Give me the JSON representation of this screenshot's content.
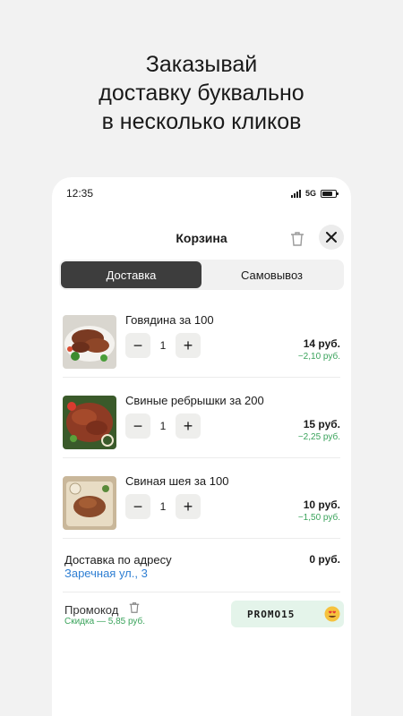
{
  "headline": [
    "Заказывай",
    "доставку буквально",
    "в несколько кликов"
  ],
  "status": {
    "time": "12:35",
    "network": "5G"
  },
  "cart": {
    "title": "Корзина",
    "tabs": [
      {
        "label": "Доставка",
        "active": true
      },
      {
        "label": "Самовывоз",
        "active": false
      }
    ],
    "items": [
      {
        "name": "Говядина за 100",
        "qty": "1",
        "price": "14 руб.",
        "discount": "−2,10 руб."
      },
      {
        "name": "Свиные ребрышки за 200",
        "qty": "1",
        "price": "15 руб.",
        "discount": "−2,25 руб."
      },
      {
        "name": "Свиная шея за 100",
        "qty": "1",
        "price": "10 руб.",
        "discount": "−1,50 руб."
      }
    ],
    "delivery": {
      "label": "Доставка по адресу",
      "address": "Заречная ул., 3",
      "price": "0 руб."
    },
    "promo": {
      "label": "Промокод",
      "discount": "Скидка — 5,85 руб.",
      "code": "PROMO15"
    }
  },
  "colors": {
    "accent_green": "#3aa35b",
    "link_blue": "#2f7fd3",
    "active_tab": "#3d3d3d"
  }
}
